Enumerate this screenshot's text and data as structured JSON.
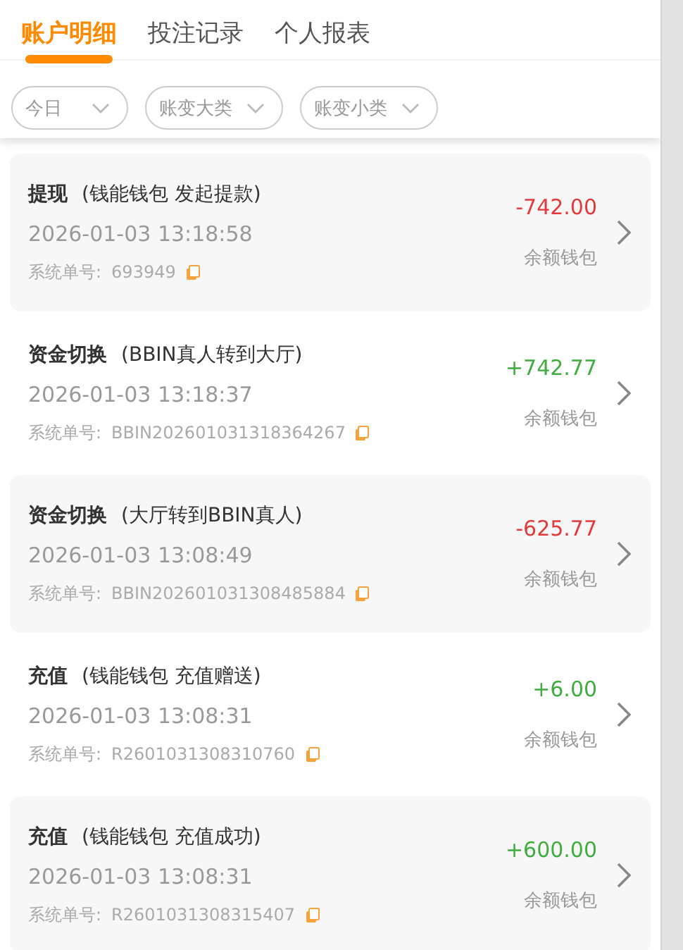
{
  "tabs": [
    {
      "label": "账户明细",
      "selected": true
    },
    {
      "label": "投注记录",
      "selected": false
    },
    {
      "label": "个人报表",
      "selected": false
    }
  ],
  "filters": [
    {
      "label": "今日"
    },
    {
      "label": "账变大类"
    },
    {
      "label": "账变小类"
    }
  ],
  "records": [
    {
      "type": "提现",
      "detail": "(钱能钱包 发起提款)",
      "time": "2026-01-03 13:18:58",
      "order_label": "系统单号:",
      "order_no": "693949",
      "amount": "-742.00",
      "kind": "expense",
      "wallet": "余额钱包"
    },
    {
      "type": "资金切换",
      "detail": "(BBIN真人转到大厅)",
      "time": "2026-01-03 13:18:37",
      "order_label": "系统单号:",
      "order_no": "BBIN202601031318364267",
      "amount": "+742.77",
      "kind": "income",
      "wallet": "余额钱包"
    },
    {
      "type": "资金切换",
      "detail": "(大厅转到BBIN真人)",
      "time": "2026-01-03 13:08:49",
      "order_label": "系统单号:",
      "order_no": "BBIN202601031308485884",
      "amount": "-625.77",
      "kind": "expense",
      "wallet": "余额钱包"
    },
    {
      "type": "充值",
      "detail": "(钱能钱包 充值赠送)",
      "time": "2026-01-03 13:08:31",
      "order_label": "系统单号:",
      "order_no": "R2601031308310760",
      "amount": "+6.00",
      "kind": "income",
      "wallet": "余额钱包"
    },
    {
      "type": "充值",
      "detail": "(钱能钱包 充值成功)",
      "time": "2026-01-03 13:08:31",
      "order_label": "系统单号:",
      "order_no": "R2601031308315407",
      "amount": "+600.00",
      "kind": "income",
      "wallet": "余额钱包"
    }
  ]
}
